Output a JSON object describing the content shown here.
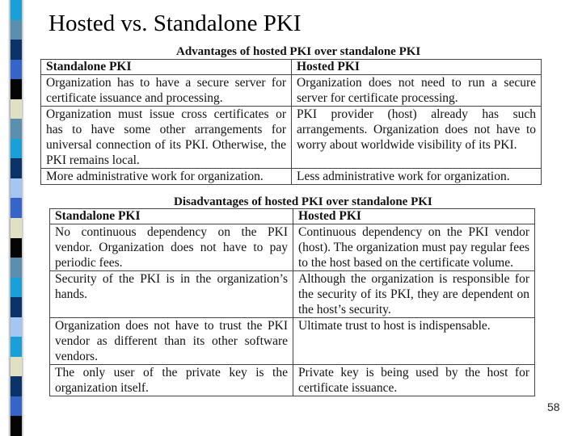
{
  "slide": {
    "title": "Hosted vs. Standalone PKI",
    "page_number": "58",
    "stripe_colors": [
      "#1aa0d8",
      "#5a8fb0",
      "#0b3368",
      "#3565c8",
      "#050505",
      "#e2e0c2",
      "#5a8fb0",
      "#1aa0d8",
      "#0b3368",
      "#a4c6f2",
      "#3565c8",
      "#e2e0c2",
      "#050505",
      "#5a8fb0",
      "#1aa0d8",
      "#0b3368",
      "#a4c6f2",
      "#1aa0d8",
      "#e2e0c2",
      "#0b3368",
      "#3565c8",
      "#050505"
    ]
  },
  "advantages": {
    "caption": "Advantages of hosted PKI over standalone PKI",
    "headers": [
      "Standalone PKI",
      "Hosted PKI"
    ],
    "rows": [
      [
        "Organization has to have a secure server for certificate issuance and processing.",
        "Organization does not need to run a secure server for certificate processing."
      ],
      [
        "Organization must issue cross certificates or has to have some other arrangements for universal connection of its PKI. Otherwise, the PKI remains local.",
        "PKI provider (host) already has such arrangements. Organization does not have to worry about worldwide visibility of its PKI."
      ],
      [
        "More administrative work for organization.",
        "Less administrative work for organization."
      ]
    ]
  },
  "disadvantages": {
    "caption": "Disadvantages of hosted PKI over standalone PKI",
    "headers": [
      "Standalone PKI",
      "Hosted PKI"
    ],
    "rows": [
      [
        "No continuous dependency on the PKI vendor. Organization does not have to pay periodic fees.",
        "Continuous dependency on the PKI vendor (host). The organization must pay regular fees to the host based on the certificate volume."
      ],
      [
        "Security of the PKI is in the organization’s hands.",
        "Although the organization is responsible for the security of its PKI, they are dependent on the host’s security."
      ],
      [
        "Organization does not have to trust the PKI vendor as different than its other software vendors.",
        "Ultimate trust to host is indispensable."
      ],
      [
        "The only user of the private key is the organization itself.",
        "Private key is being used by the host for certificate issuance."
      ]
    ]
  }
}
